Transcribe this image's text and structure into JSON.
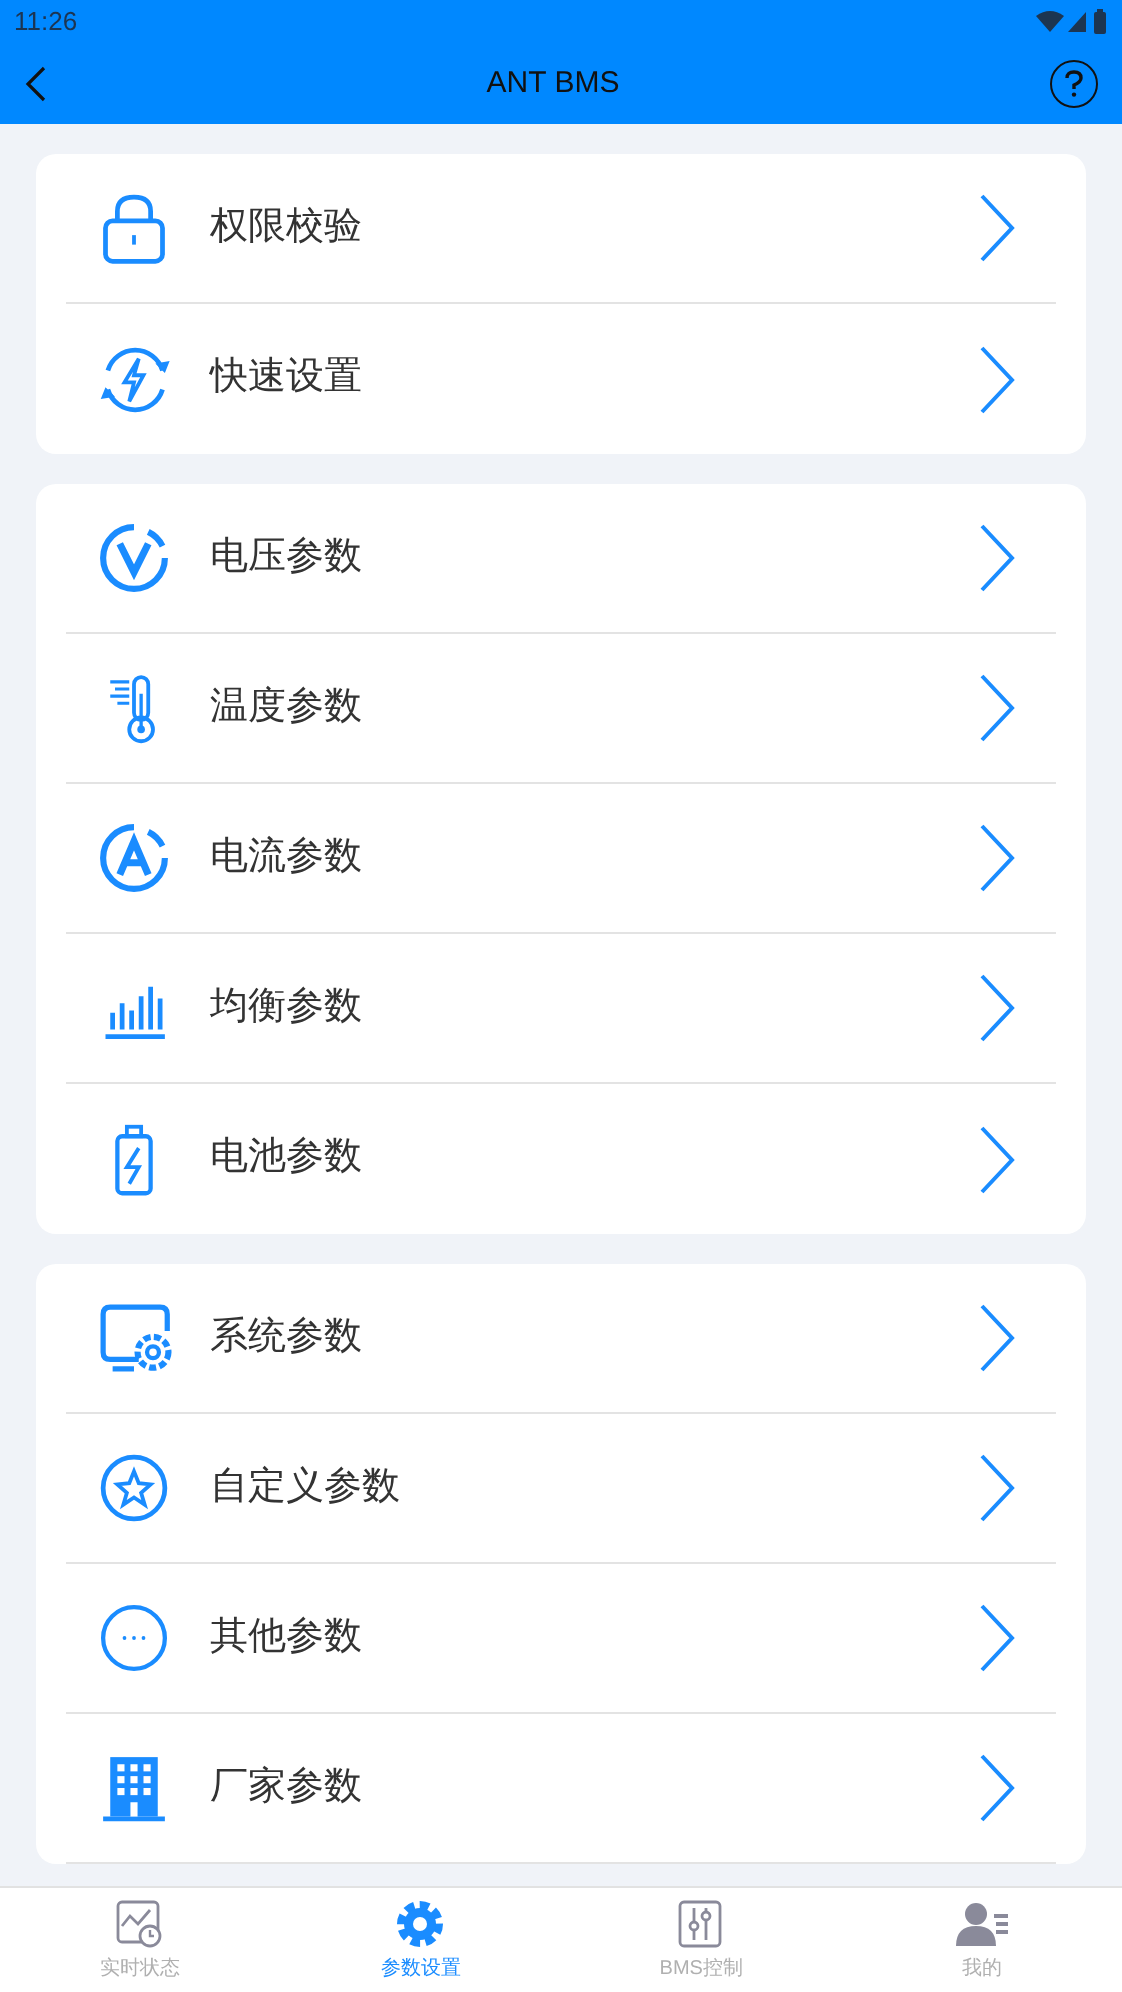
{
  "status_bar": {
    "time": "11:26"
  },
  "header": {
    "title": "ANT BMS"
  },
  "groups": [
    {
      "items": [
        {
          "label": "权限校验",
          "kind": "lock"
        },
        {
          "label": "快速设置",
          "kind": "refresh"
        }
      ]
    },
    {
      "items": [
        {
          "label": "电压参数",
          "kind": "voltage"
        },
        {
          "label": "温度参数",
          "kind": "thermometer"
        },
        {
          "label": "电流参数",
          "kind": "current"
        },
        {
          "label": "均衡参数",
          "kind": "bars"
        },
        {
          "label": "电池参数",
          "kind": "battery"
        }
      ]
    },
    {
      "items": [
        {
          "label": "系统参数",
          "kind": "monitor"
        },
        {
          "label": "自定义参数",
          "kind": "star"
        },
        {
          "label": "其他参数",
          "kind": "more"
        },
        {
          "label": "厂家参数",
          "kind": "building"
        }
      ]
    }
  ],
  "tab_bar": [
    {
      "label": "实时状态",
      "kind": "chart",
      "selected": false
    },
    {
      "label": "参数设置",
      "kind": "gear",
      "selected": true
    },
    {
      "label": "BMS控制",
      "kind": "sliders",
      "selected": false
    },
    {
      "label": "我的",
      "kind": "person",
      "selected": false
    }
  ]
}
